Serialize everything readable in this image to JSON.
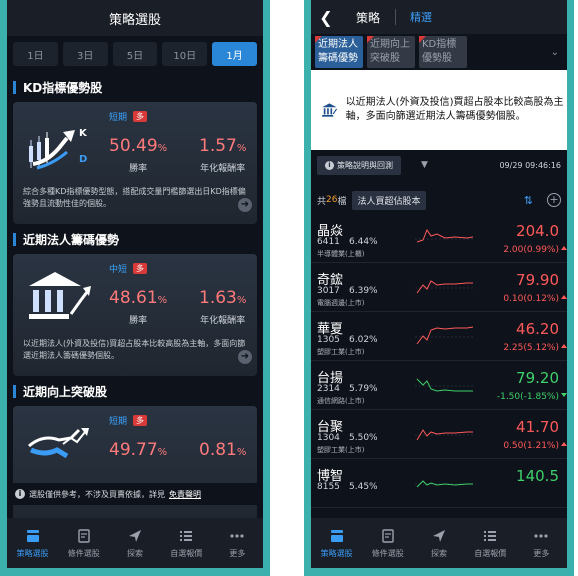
{
  "left": {
    "header_title": "策略選股",
    "periods": [
      {
        "label": "1日",
        "active": false
      },
      {
        "label": "3日",
        "active": false
      },
      {
        "label": "5日",
        "active": false
      },
      {
        "label": "10日",
        "active": false
      },
      {
        "label": "1月",
        "active": true
      }
    ],
    "cards": [
      {
        "title": "KD指標優勢股",
        "term": "短期",
        "direction": "多",
        "win_rate": "50.49",
        "annual_return": "1.57",
        "win_label": "勝率",
        "annual_label": "年化報酬率",
        "description": "綜合多種KD指標優勢型態，搭配成交量門檻篩選出日KD指標偏強勢且流動性佳的個股。",
        "icon": "kd-chart-icon"
      },
      {
        "title": "近期法人籌碼優勢",
        "term": "中短",
        "direction": "多",
        "win_rate": "48.61",
        "annual_return": "1.63",
        "win_label": "勝率",
        "annual_label": "年化報酬率",
        "description": "以近期法人(外資及投信)買超占股本比較高股為主軸，多面向篩選近期法人籌碼優勢個股。",
        "icon": "institution-icon"
      },
      {
        "title": "近期向上突破股",
        "term": "短期",
        "direction": "多",
        "win_rate": "49.77",
        "annual_return": "0.81",
        "icon": "bull-breakout-icon"
      }
    ],
    "pct_sign": "%",
    "disclaimer_text": "選股僅供參考，不涉及買賣依據，詳見",
    "disclaimer_link": "免責聲明",
    "nav": [
      {
        "label": "策略選股",
        "icon": "strategy-icon",
        "active": true
      },
      {
        "label": "條件選股",
        "icon": "condition-icon",
        "active": false
      },
      {
        "label": "探索",
        "icon": "explore-icon",
        "active": false
      },
      {
        "label": "自選報價",
        "icon": "watchlist-icon",
        "active": false
      },
      {
        "label": "更多",
        "icon": "more-icon",
        "active": false
      }
    ]
  },
  "right": {
    "header_title": "策略",
    "header_sub": "精選",
    "chips": [
      {
        "label": "近期法人籌碼優勢",
        "active": true
      },
      {
        "label": "近期向上突破股",
        "active": false
      },
      {
        "label": "KD指標優勢股",
        "active": false
      }
    ],
    "strategy_desc": "以近期法人(外資及投信)買超占股本比較高股為主軸，多面向篩選近期法人籌碼優勢個股。",
    "explain_label": "策略說明與回測",
    "timestamp": "09/29 09:46:16",
    "count_prefix": "共",
    "count": "26",
    "count_suffix": "檔",
    "sort_label": "法人買超佔股本",
    "stocks": [
      {
        "name": "晶焱",
        "code": "6411",
        "rate": "6.44%",
        "industry": "半導體業(上櫃)",
        "price": "204.0",
        "change": "2.00(0.99%)",
        "dir": "up"
      },
      {
        "name": "奇鋐",
        "code": "3017",
        "rate": "6.39%",
        "industry": "電腦週邊(上市)",
        "price": "79.90",
        "change": "0.10(0.12%)",
        "dir": "up"
      },
      {
        "name": "華夏",
        "code": "1305",
        "rate": "6.02%",
        "industry": "塑膠工業(上市)",
        "price": "46.20",
        "change": "2.25(5.12%)",
        "dir": "up"
      },
      {
        "name": "台揚",
        "code": "2314",
        "rate": "5.79%",
        "industry": "通信網路(上市)",
        "price": "79.20",
        "change": "-1.50(-1.85%)",
        "dir": "down"
      },
      {
        "name": "台聚",
        "code": "1304",
        "rate": "5.50%",
        "industry": "塑膠工業(上市)",
        "price": "41.70",
        "change": "0.50(1.21%)",
        "dir": "up"
      },
      {
        "name": "博智",
        "code": "8155",
        "rate": "5.45%",
        "industry": "",
        "price": "140.5",
        "change": "",
        "dir": "down"
      }
    ],
    "nav": [
      {
        "label": "策略選股",
        "icon": "strategy-icon",
        "active": true
      },
      {
        "label": "條件選股",
        "icon": "condition-icon",
        "active": false
      },
      {
        "label": "探索",
        "icon": "explore-icon",
        "active": false
      },
      {
        "label": "自選報價",
        "icon": "watchlist-icon",
        "active": false
      },
      {
        "label": "更多",
        "icon": "more-icon",
        "active": false
      }
    ]
  }
}
